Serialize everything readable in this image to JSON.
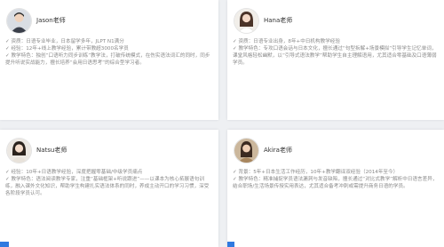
{
  "teachers": [
    {
      "name": "Jason老师",
      "lines": [
        "✓ 资质：日语专业毕业，日本留学多年，JLPT N1满分",
        "✓ 经验：12年+线上教学经验，累计带教超3000名学员",
        "✓ 教学特色：独创“口语听力同步训练”教学法，打破传统模式，在伤实语法词汇的同时，同步提升听说实战能力，擅长培养“会用日语思考”的综合型学习者。"
      ]
    },
    {
      "name": "Hana老师",
      "lines": [
        "✓ 资质：日语专业出身，8年+中日机构教学经验",
        "✓ 教学特色：专攻口语会话与日本文化，擅长通过“句型拆解+场景模拟”引导学生记忆单词，课堂风格轻松幽默，以“引导式语法教学”帮助学生自主理解语用，尤其适合零基础及口语薄弱学员。"
      ]
    },
    {
      "name": "Natsu老师",
      "lines": [
        "✓ 经验：10年+日语教学经验，深度把握零基础/中级学员痛点",
        "✓ 教学特色：语法阅读教学专家，注重“基础框架+听说跟进”——以课本为核心拓展语句训练，融入课外文化知识，帮助学生构建扎实语法体系的同时，养成主动开口的学习习惯，深受各阶段学员认可。"
      ]
    },
    {
      "name": "Akira老师",
      "lines": [
        "✓ 背景：5年+日本生活工作经历，10年+教学翻译双经验（2014年至今）",
        "✓ 教学特色：精准捕捉学员语法漏洞与发音缺陷，擅长通过“对比式教学”解析中日语言差异，结合职场/生活场景传授实用表达，尤其适合备考冲刺或需提升商务日语的学员。"
      ]
    }
  ]
}
